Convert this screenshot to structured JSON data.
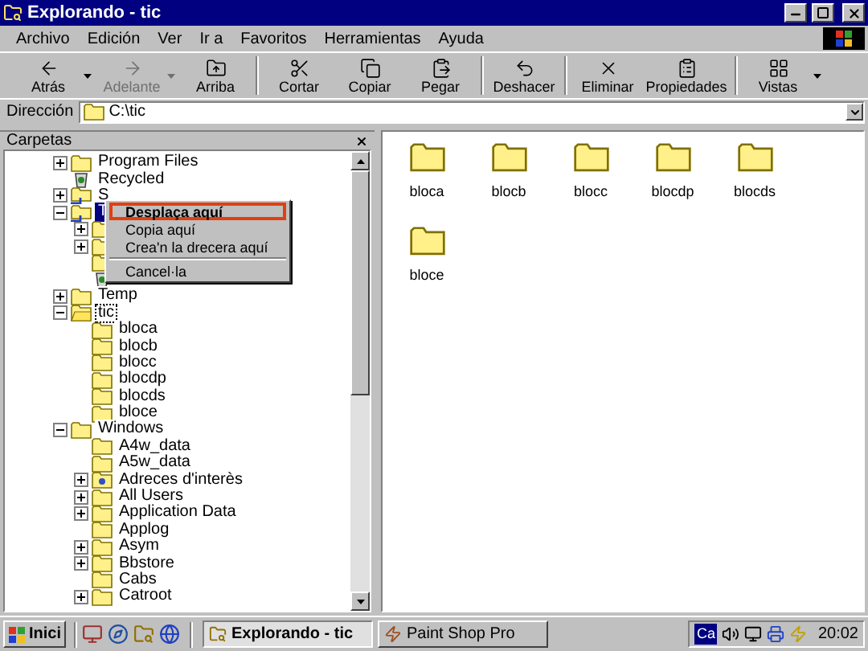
{
  "window": {
    "title": "Explorando - tic"
  },
  "menu_bar": [
    "Archivo",
    "Edición",
    "Ver",
    "Ir a",
    "Favoritos",
    "Herramientas",
    "Ayuda"
  ],
  "toolbar": [
    [
      {
        "label": "Atrás",
        "disabled": false,
        "dropdown": true
      },
      {
        "label": "Adelante",
        "disabled": true,
        "dropdown": true
      },
      {
        "label": "Arriba",
        "disabled": false,
        "dropdown": false
      }
    ],
    [
      {
        "label": "Cortar",
        "disabled": false,
        "dropdown": false
      },
      {
        "label": "Copiar",
        "disabled": false,
        "dropdown": false
      },
      {
        "label": "Pegar",
        "disabled": false,
        "dropdown": false
      }
    ],
    [
      {
        "label": "Deshacer",
        "disabled": false,
        "dropdown": false
      }
    ],
    [
      {
        "label": "Eliminar",
        "disabled": false,
        "dropdown": false
      },
      {
        "label": "Propiedades",
        "disabled": false,
        "dropdown": false
      }
    ],
    [
      {
        "label": "Vistas",
        "disabled": false,
        "dropdown": true
      }
    ]
  ],
  "address": {
    "label": "Dirección",
    "value": "C:\\tic"
  },
  "folders_pane": {
    "title": "Carpetas",
    "tree": [
      {
        "label": "Program Files",
        "kind": "folder",
        "expanded": false,
        "selected": false,
        "focused": false
      },
      {
        "label": "Recycled",
        "kind": "recycle",
        "selected": false,
        "focused": false
      },
      {
        "label": "S",
        "kind": "shared",
        "expanded": false,
        "selected": false,
        "focused": false
      },
      {
        "label": "T",
        "kind": "shared",
        "expanded": true,
        "selected": true,
        "focused": false,
        "children": [
          {
            "kind": "folder",
            "expanded": false
          },
          {
            "kind": "folder",
            "expanded": false
          },
          {
            "kind": "folder"
          },
          {
            "kind": "recycle"
          }
        ]
      },
      {
        "label": "Temp",
        "kind": "folder",
        "expanded": false,
        "selected": false,
        "focused": false
      },
      {
        "label": "tic",
        "kind": "openfolder",
        "expanded": true,
        "selected": false,
        "focused": true,
        "children": [
          {
            "label": "bloca",
            "kind": "folder",
            "selected": false,
            "focused": false
          },
          {
            "label": "blocb",
            "kind": "folder",
            "selected": false,
            "focused": false
          },
          {
            "label": "blocc",
            "kind": "folder",
            "selected": false,
            "focused": false
          },
          {
            "label": "blocdp",
            "kind": "folder",
            "selected": false,
            "focused": false
          },
          {
            "label": "blocds",
            "kind": "folder",
            "selected": false,
            "focused": false
          },
          {
            "label": "bloce",
            "kind": "folder",
            "selected": false,
            "focused": false
          }
        ]
      },
      {
        "label": "Windows",
        "kind": "folder",
        "expanded": true,
        "selected": false,
        "focused": false,
        "children": [
          {
            "label": "A4w_data",
            "kind": "folder",
            "selected": false,
            "focused": false
          },
          {
            "label": "A5w_data",
            "kind": "folder",
            "selected": false,
            "focused": false
          },
          {
            "label": "Adreces d'interès",
            "kind": "special",
            "expanded": false,
            "selected": false,
            "focused": false
          },
          {
            "label": "All Users",
            "kind": "folder",
            "expanded": false,
            "selected": false,
            "focused": false
          },
          {
            "label": "Application Data",
            "kind": "folder",
            "expanded": false,
            "selected": false,
            "focused": false
          },
          {
            "label": "Applog",
            "kind": "folder",
            "selected": false,
            "focused": false
          },
          {
            "label": "Asym",
            "kind": "folder",
            "expanded": false,
            "selected": false,
            "focused": false
          },
          {
            "label": "Bbstore",
            "kind": "folder",
            "expanded": false,
            "selected": false,
            "focused": false
          },
          {
            "label": "Cabs",
            "kind": "folder",
            "selected": false,
            "focused": false
          },
          {
            "label": "Catroot",
            "kind": "folder",
            "expanded": false,
            "selected": false,
            "focused": false
          }
        ]
      }
    ],
    "context_menu": [
      [
        {
          "label": "Desplaça aquí",
          "selected": true
        },
        {
          "label": "Copia aquí",
          "selected": false
        },
        {
          "label": "Crea'n la drecera aquí",
          "selected": false
        }
      ],
      [
        {
          "label": "Cancel·la",
          "selected": false
        }
      ]
    ]
  },
  "contents": [
    "bloca",
    "blocb",
    "blocc",
    "blocdp",
    "blocds",
    "bloce"
  ],
  "taskbar": {
    "start": "Inici",
    "tasks": [
      {
        "label": "Explorando - tic",
        "selected": true
      },
      {
        "label": "Paint Shop Pro",
        "selected": false
      }
    ],
    "language": "Ca",
    "clock": "20:02"
  }
}
